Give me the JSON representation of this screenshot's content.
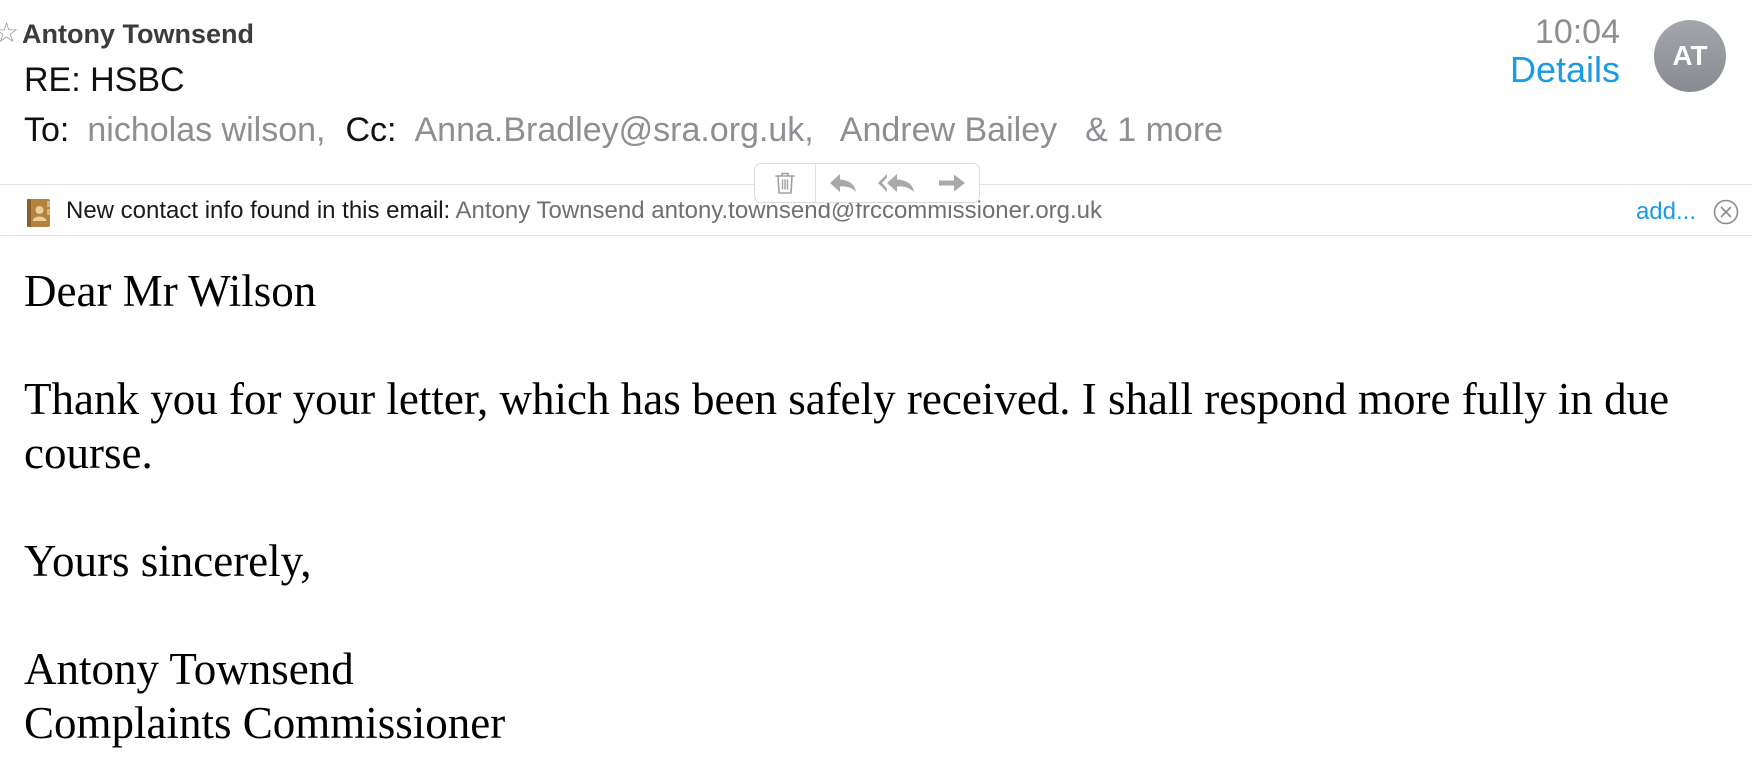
{
  "header": {
    "sender": "Antony Townsend",
    "subject": "RE: HSBC",
    "to_label": "To:",
    "to": "nicholas wilson,",
    "cc_label": "Cc:",
    "cc": [
      "Anna.Bradley@sra.org.uk,",
      "Andrew Bailey"
    ],
    "more": "& 1 more",
    "time": "10:04",
    "details_label": "Details",
    "avatar_initials": "AT"
  },
  "toolbar": {
    "icons": [
      "trash-icon",
      "reply-icon",
      "reply-all-icon",
      "forward-icon"
    ]
  },
  "contact_banner": {
    "label": "New contact info found in this email:",
    "contact": "Antony Townsend antony.townsend@frccommissioner.org.uk",
    "add_label": "add..."
  },
  "body": {
    "greeting": "Dear Mr Wilson",
    "paragraph": "Thank you for your letter, which has been safely received. I shall respond more fully in due course.",
    "closing": "Yours sincerely,",
    "signature_name": "Antony Townsend",
    "signature_title": "Complaints Commissioner"
  },
  "colors": {
    "accent": "#1a9be6",
    "muted": "#8e8e93",
    "avatar": "#95989d"
  }
}
